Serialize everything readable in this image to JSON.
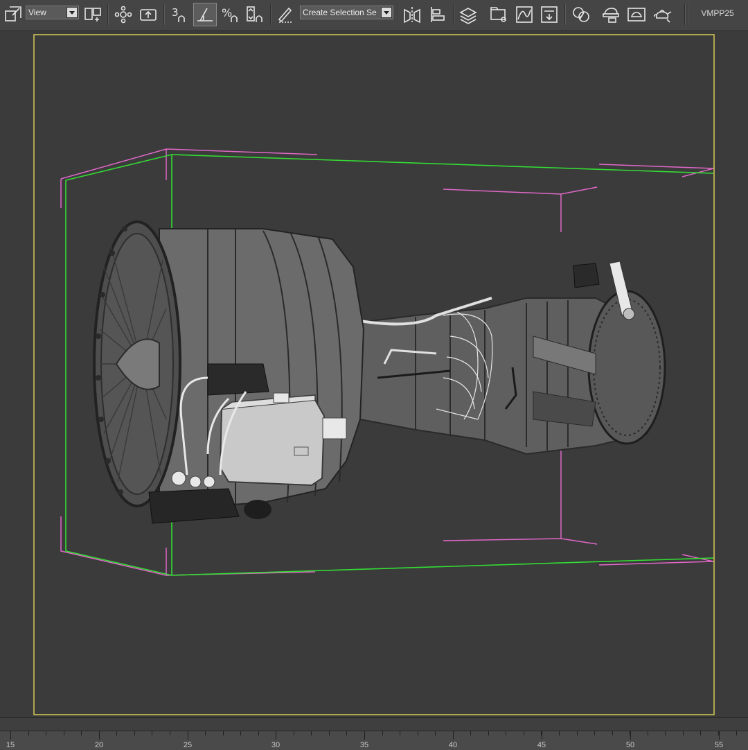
{
  "toolbar": {
    "view_combo": {
      "value": "View"
    },
    "selection_set_combo": {
      "value": "Create Selection Se"
    },
    "workspace_label": "VMPP25",
    "snap_angle_label": "3",
    "percent_snap_label": "%"
  },
  "timeline": {
    "ticks": [
      "15",
      "20",
      "25",
      "30",
      "35",
      "40",
      "45",
      "50",
      "55"
    ]
  },
  "colors": {
    "selection_bracket": "#f0e060",
    "bbox_pink": "#e060c0",
    "bbox_green": "#30e030",
    "model_gray": "#6e6e6e"
  }
}
